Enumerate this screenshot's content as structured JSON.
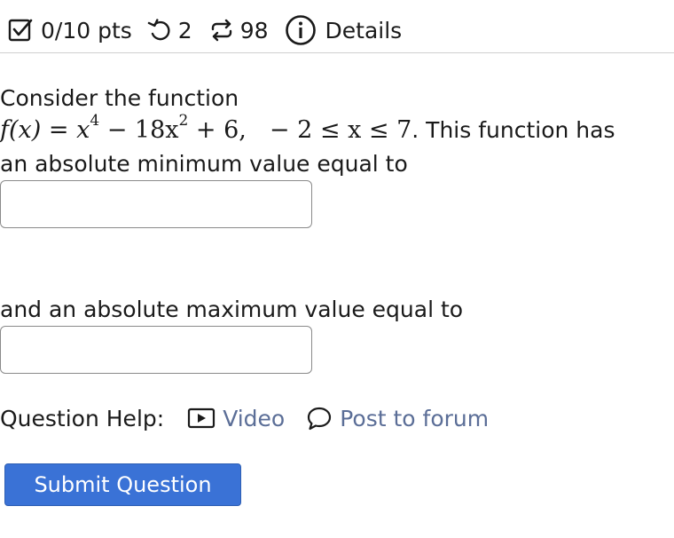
{
  "header": {
    "score": "0/10 pts",
    "attempts": "2",
    "versions": "98",
    "details_label": "Details"
  },
  "question": {
    "intro": "Consider the function",
    "function_lhs": "f(x) = x",
    "exp1": "4",
    "middle": " − 18x",
    "exp2": "2",
    "tail": " + 6,",
    "domain": "− 2 ≤ x ≤ 7",
    "has_text": ". This function has",
    "min_label": "an absolute minimum value equal to",
    "max_label": "and an absolute maximum value equal to",
    "min_value": "",
    "max_value": ""
  },
  "help": {
    "label": "Question Help:",
    "video": "Video",
    "forum": "Post to forum"
  },
  "submit_label": "Submit Question"
}
